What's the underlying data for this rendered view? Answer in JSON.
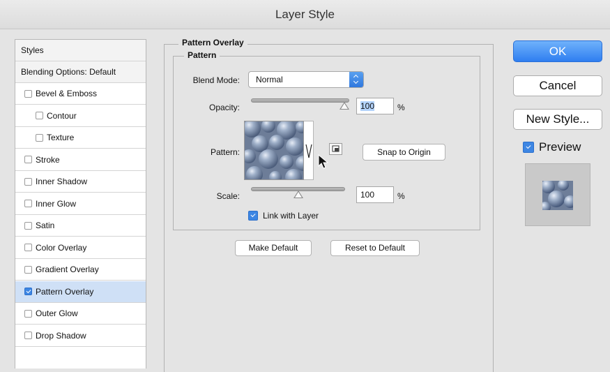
{
  "window": {
    "title": "Layer Style"
  },
  "styles_panel": {
    "header": "Styles",
    "blending_options": "Blending Options: Default",
    "items": [
      {
        "label": "Bevel & Emboss",
        "checked": false,
        "indent": false
      },
      {
        "label": "Contour",
        "checked": false,
        "indent": true
      },
      {
        "label": "Texture",
        "checked": false,
        "indent": true
      },
      {
        "label": "Stroke",
        "checked": false,
        "indent": false
      },
      {
        "label": "Inner Shadow",
        "checked": false,
        "indent": false
      },
      {
        "label": "Inner Glow",
        "checked": false,
        "indent": false
      },
      {
        "label": "Satin",
        "checked": false,
        "indent": false
      },
      {
        "label": "Color Overlay",
        "checked": false,
        "indent": false
      },
      {
        "label": "Gradient Overlay",
        "checked": false,
        "indent": false
      },
      {
        "label": "Pattern Overlay",
        "checked": true,
        "indent": false,
        "selected": true
      },
      {
        "label": "Outer Glow",
        "checked": false,
        "indent": false
      },
      {
        "label": "Drop Shadow",
        "checked": false,
        "indent": false
      }
    ]
  },
  "pattern_overlay": {
    "section_title": "Pattern Overlay",
    "group_title": "Pattern",
    "blend_mode_label": "Blend Mode:",
    "blend_mode_value": "Normal",
    "opacity_label": "Opacity:",
    "opacity_value": "100",
    "opacity_fraction": 1.0,
    "opacity_unit": "%",
    "pattern_label": "Pattern:",
    "snap_to_origin": "Snap to Origin",
    "scale_label": "Scale:",
    "scale_value": "100",
    "scale_unit": "%",
    "link_with_layer_label": "Link with Layer",
    "link_with_layer_checked": true,
    "make_default": "Make Default",
    "reset_to_default": "Reset to Default"
  },
  "actions": {
    "ok": "OK",
    "cancel": "Cancel",
    "new_style": "New Style...",
    "preview_label": "Preview",
    "preview_checked": true
  },
  "colors": {
    "accent": "#3d86e3",
    "selection": "#cfe0f6",
    "pattern_tint": "#8a9cb8"
  }
}
